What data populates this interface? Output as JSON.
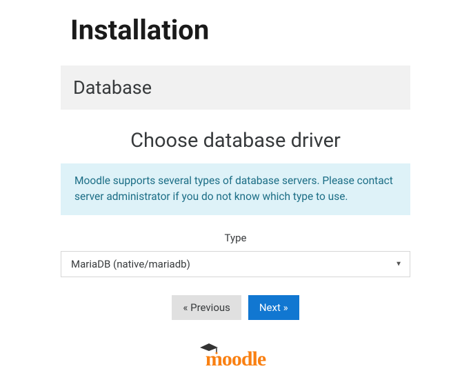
{
  "page": {
    "title": "Installation"
  },
  "section": {
    "header": "Database",
    "subheading": "Choose database driver"
  },
  "info": {
    "text": "Moodle supports several types of database servers. Please contact server administrator if you do not know which type to use."
  },
  "form": {
    "type_label": "Type",
    "type_selected": "MariaDB (native/mariadb)"
  },
  "nav": {
    "prev": "« Previous",
    "next": "Next »"
  },
  "brand": {
    "name": "moodle"
  }
}
